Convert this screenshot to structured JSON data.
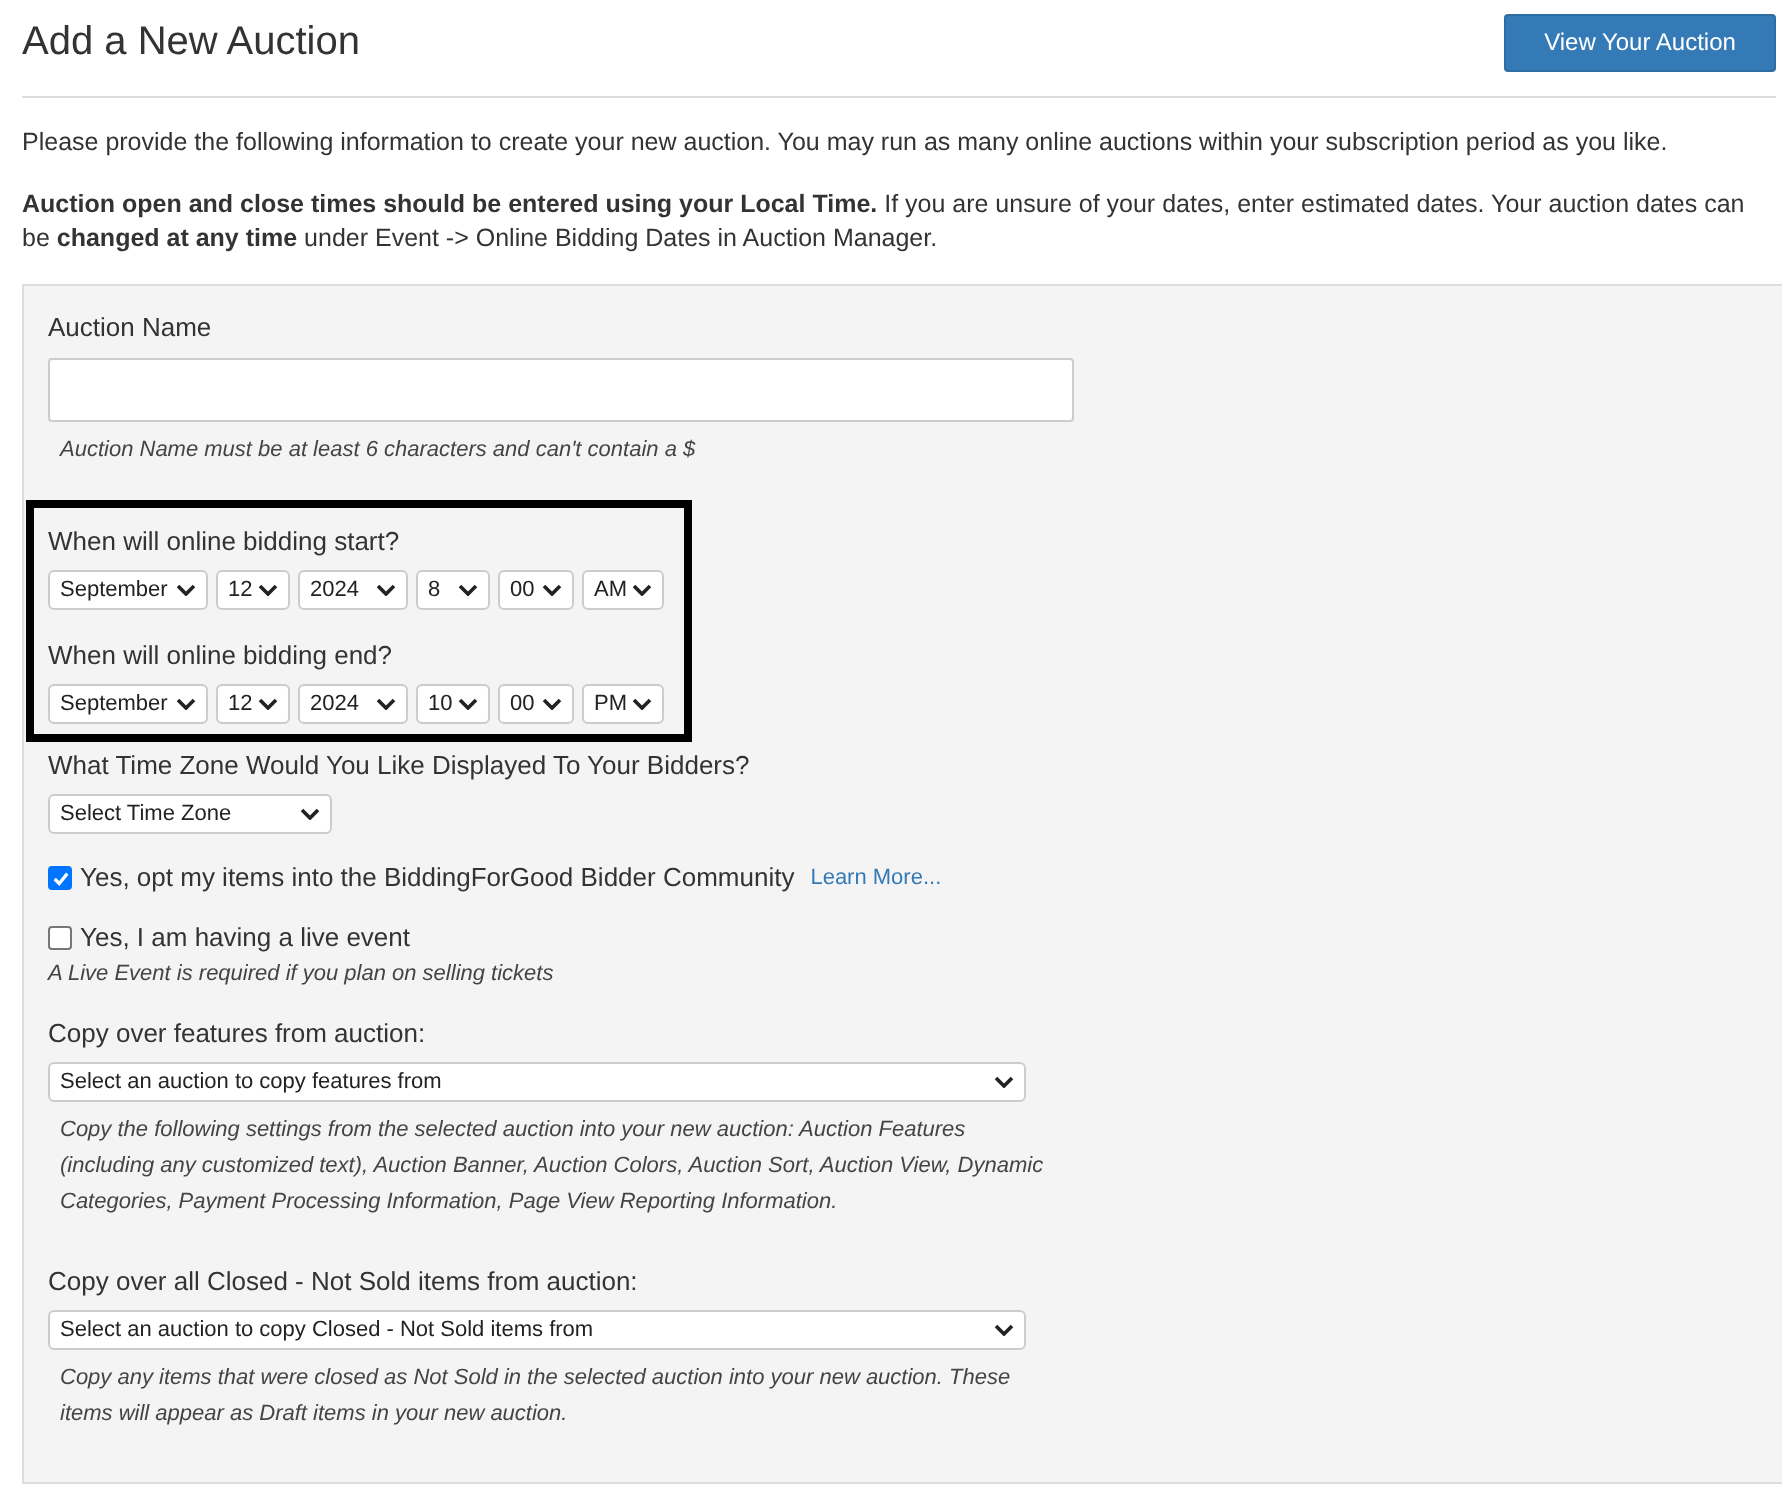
{
  "header": {
    "title": "Add a New Auction",
    "button": "View Your Auction"
  },
  "intro": [
    "Please provide the following information to create your new auction. You may run as many online auctions within your subscription period as you like.",
    "**Auction open and close times should be entered using your Local Time.** If you are unsure of your dates, enter estimated dates. Your auction dates can be **changed at any time** under Event -> Online Bidding Dates in Auction Manager."
  ],
  "form": {
    "auction_name": {
      "label": "Auction Name",
      "hint": "Auction Name must be at least 6 characters and can't contain a $"
    },
    "bidding_dates": [
      {
        "label": "When will online bidding start?",
        "fields": [
          "September",
          "12",
          "2024",
          "8",
          "00",
          "AM"
        ]
      },
      {
        "label": "When will online bidding end?",
        "fields": [
          "September",
          "12",
          "2024",
          "10",
          "00",
          "PM"
        ]
      }
    ],
    "time_zone": {
      "label": "What Time Zone Would You Like Displayed To Your Bidders?",
      "value": "Select Time Zone"
    },
    "options": [
      {
        "label": "Yes, opt my items into the BiddingForGood Bidder Community",
        "checked": true,
        "link": "Learn More..."
      },
      {
        "label": "Yes, I am having a live event",
        "checked": false,
        "hint": "A Live Event is required if you plan on selling tickets"
      }
    ],
    "copy_sections": [
      {
        "label": "Copy over features from auction:",
        "value": "Select an auction to copy features from",
        "hint": "Copy the following settings from the selected auction into your new auction: Auction Features (including any customized text), Auction Banner, Auction Colors, Auction Sort, Auction View, Dynamic Categories, Payment Processing Information, Page View Reporting Information."
      },
      {
        "label": "Copy over all Closed - Not Sold items from auction:",
        "value": "Select an auction to copy Closed - Not Sold items from",
        "hint": "Copy any items that were closed as Not Sold in the selected auction into your new auction. These items will appear as Draft items in your new auction."
      }
    ]
  }
}
